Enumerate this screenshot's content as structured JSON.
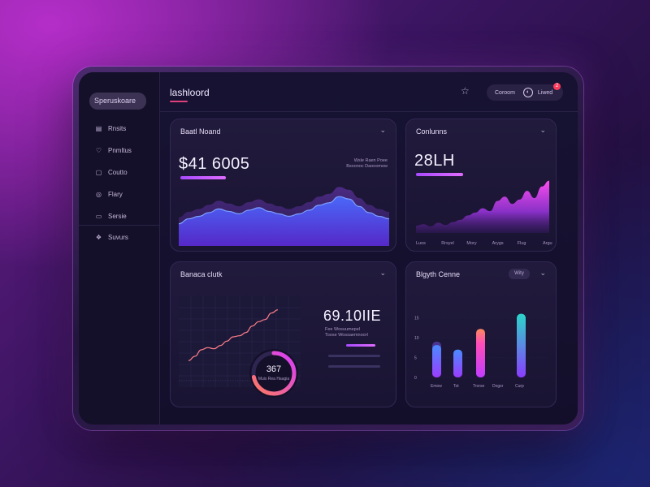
{
  "sidebar": {
    "brand": "Speruskoare",
    "items": [
      {
        "label": "Rnsits",
        "icon": "clipboard-icon"
      },
      {
        "label": "Pnmltus",
        "icon": "heart-icon"
      },
      {
        "label": "Coutto",
        "icon": "box-icon"
      },
      {
        "label": "Flary",
        "icon": "shield-icon"
      },
      {
        "label": "Sersie",
        "icon": "inbox-icon"
      },
      {
        "label": "Suvurs",
        "icon": "cube-icon"
      }
    ]
  },
  "topbar": {
    "title": "lashloord",
    "star_icon": "star-icon",
    "user_label": "Coroom",
    "user_name": "Liwed",
    "notification_count": "2"
  },
  "cards": {
    "revenue": {
      "title": "Baatl Noand",
      "value": "$41 6005",
      "note_line1": "Wsle Raen Poee",
      "note_line2": "Bsoonoc Daooomow",
      "chart_data": {
        "type": "area",
        "series": [
          {
            "values": [
              18,
              22,
              24,
              27,
              30,
              28,
              26,
              29,
              31,
              28,
              26,
              24,
              26,
              29,
              33,
              35,
              40,
              38,
              32,
              27,
              24,
              22
            ]
          }
        ]
      }
    },
    "conversions": {
      "title": "Conlunns",
      "value": "28LH",
      "x_labels": [
        "Luos",
        "Rrsyel",
        "Mory",
        "Arygs",
        "Flug",
        "Argu"
      ],
      "chart_data": {
        "type": "area",
        "series": [
          {
            "values": [
              10,
              12,
              9,
              14,
              11,
              15,
              18,
              24,
              28,
              34,
              30,
              44,
              50,
              40,
              46,
              58,
              48,
              64,
              72
            ]
          }
        ]
      }
    },
    "balance": {
      "title": "Banaca clutk",
      "value": "69.10IIE",
      "note_line1": "Fee Wosuumepel",
      "note_line2": "Toose Wossaemnoorl",
      "gauge": {
        "value": "367",
        "sub": "Muis Rea\nHaagia",
        "fraction": 0.72
      },
      "chart_data": {
        "type": "line",
        "series": [
          {
            "values": [
              8,
              12,
              18,
              20,
              19,
              22,
              26,
              30,
              31,
              34,
              40,
              44,
              46,
              52,
              55
            ]
          }
        ]
      }
    },
    "growth": {
      "title": "Blgyth Cenne",
      "tag": "Wity",
      "y_labels": [
        "15",
        "10",
        "5",
        "0"
      ],
      "x_labels": [
        "Emow",
        "Tot",
        "Trorse",
        "Dogsr",
        "Curp"
      ],
      "chart_data": {
        "type": "bar",
        "categories": [
          "Emow",
          "Tot",
          "Trorse",
          "Dogsr",
          "Curp"
        ],
        "series": [
          {
            "values": [
              9,
              7,
              12,
              16
            ]
          },
          {
            "values": [
              5,
              0,
              8,
              0
            ]
          }
        ]
      }
    }
  },
  "colors": {
    "accent_purple": "#a84bff",
    "accent_pink": "#e040ff",
    "accent_blue": "#4a6bff",
    "accent_teal": "#2bb7d6",
    "accent_orange": "#ff8a5c"
  }
}
